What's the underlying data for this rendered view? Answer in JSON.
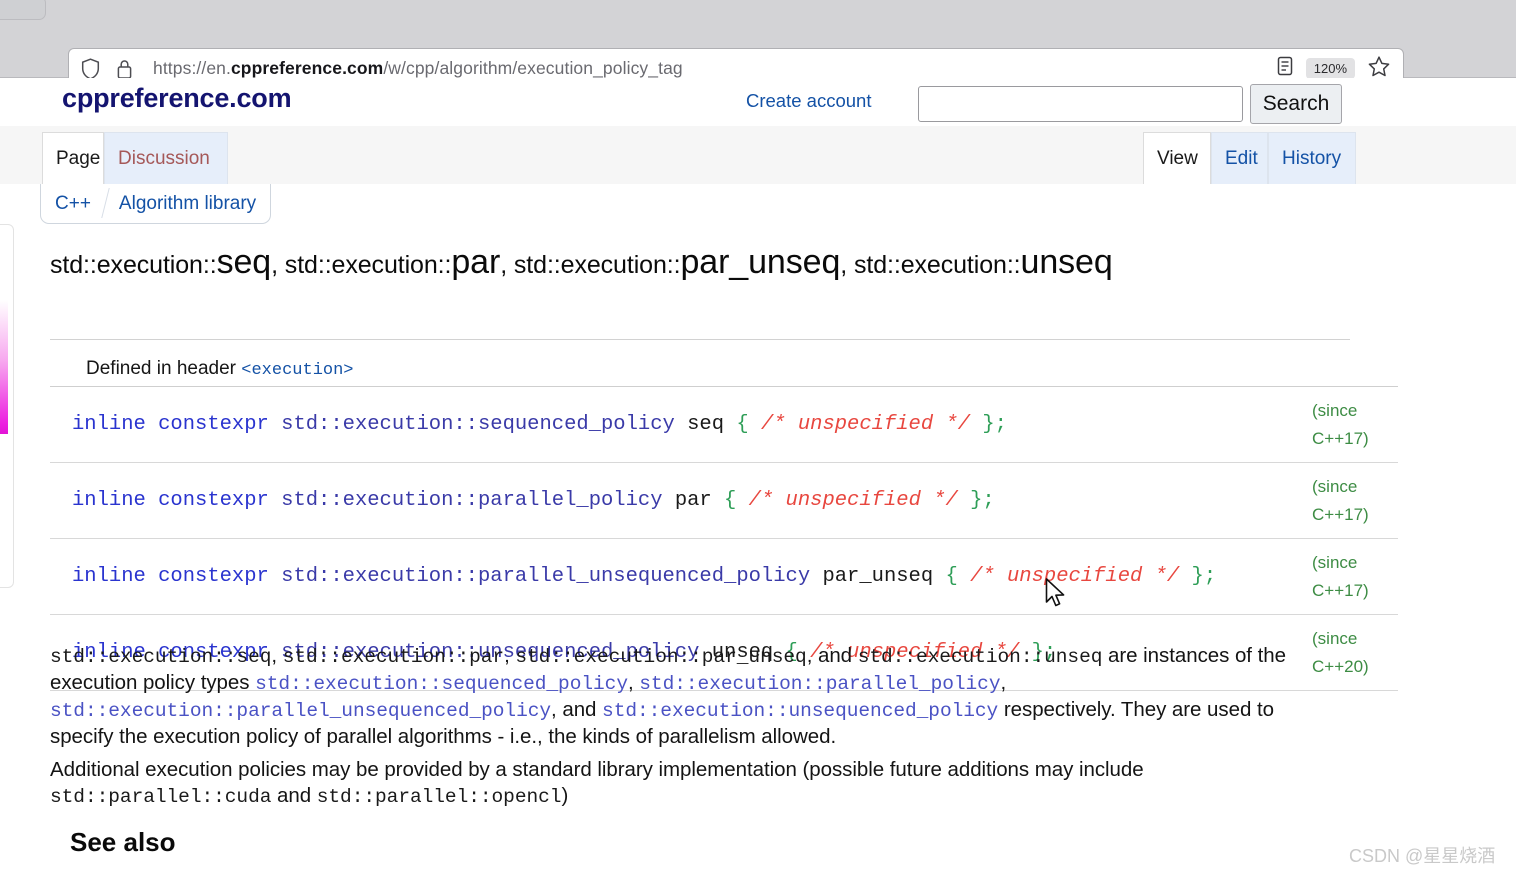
{
  "browser": {
    "url_prefix": "https://en.",
    "url_domain": "cppreference.com",
    "url_path": "/w/cpp/algorithm/execution_policy_tag",
    "zoom_level": "120%",
    "shield_icon": "shield-icon",
    "lock_icon": "lock-icon",
    "reader_icon": "reader-view-icon",
    "bookmark_icon": "star-icon"
  },
  "site": {
    "logo": "cppreference.com",
    "create_account": "Create account",
    "search_value": "",
    "search_placeholder": "",
    "search_button": "Search"
  },
  "page_tabs": {
    "left": [
      {
        "label": "Page",
        "state": "active"
      },
      {
        "label": "Discussion",
        "state": "inactive"
      }
    ],
    "right": [
      {
        "label": "View",
        "state": "active"
      },
      {
        "label": "Edit",
        "state": "link"
      },
      {
        "label": "History",
        "state": "link"
      }
    ]
  },
  "breadcrumbs": [
    {
      "label": "C++"
    },
    {
      "label": "Algorithm library"
    }
  ],
  "title": {
    "p1_small": "std::execution::",
    "p1_big": "seq",
    "sep1": ", ",
    "p2_small": "std::execution::",
    "p2_big": "par",
    "sep2": ", ",
    "p3_small": "std::execution::",
    "p3_big": "par_unseq",
    "sep3": ", ",
    "p4_small": "std::execution::",
    "p4_big": "unseq"
  },
  "decl_table": {
    "header_label": "Defined in header ",
    "header_file": "<execution>",
    "rows": [
      {
        "kw": "inline constexpr ",
        "type": "std::execution::sequenced_policy",
        "name": " seq ",
        "open": "{ ",
        "comment": "/* unspecified */",
        "close": " };",
        "version": "(since\nC++17)"
      },
      {
        "kw": "inline constexpr ",
        "type": "std::execution::parallel_policy",
        "name": " par ",
        "open": "{ ",
        "comment": "/* unspecified */",
        "close": " };",
        "version": "(since\nC++17)"
      },
      {
        "kw": "inline constexpr ",
        "type": "std::execution::parallel_unsequenced_policy",
        "name": " par_unseq ",
        "open": "{ ",
        "comment": "/* unspecified */",
        "close": " };",
        "version": "(since\nC++17)"
      },
      {
        "kw": "inline constexpr ",
        "type": "std::execution::unsequenced_policy",
        "name": " unseq ",
        "open": "{ ",
        "comment": "/* unspecified */",
        "close": " };",
        "version": "(since\nC++20)"
      }
    ]
  },
  "paragraph1": {
    "c1": "std::execution::seq",
    "t1": ", ",
    "c2": "std::execution::par",
    "t2": ", ",
    "c3": "std::execution::par_unseq",
    "t3": ", and ",
    "c4": "std::execution::unseq",
    "t4": " are instances of the execution policy types ",
    "l1": "std::execution::sequenced_policy",
    "t5": ", ",
    "l2": "std::execution::parallel_policy",
    "t6": ", ",
    "l3": "std::execution::parallel_unsequenced_policy",
    "t7": ", and ",
    "l4": "std::execution::unsequenced_policy",
    "t8": " respectively. They are used to specify the execution policy of parallel algorithms - i.e., the kinds of parallelism allowed."
  },
  "paragraph2": {
    "t1": "Additional execution policies may be provided by a standard library implementation (possible future additions may include ",
    "c1": "std::parallel::cuda",
    "t2": " and ",
    "c2": "std::parallel::opencl",
    "t3": ")"
  },
  "see_also": "See also",
  "watermark": "CSDN @星星烧酒",
  "colors": {
    "logo": "#141470",
    "link": "#1452a6",
    "keyword": "#2a34cf",
    "type": "#3a3aa8",
    "brace": "#2e9e57",
    "comment": "#e8473f",
    "version": "#3d8c44",
    "accent_strip": "#ec21e0"
  }
}
